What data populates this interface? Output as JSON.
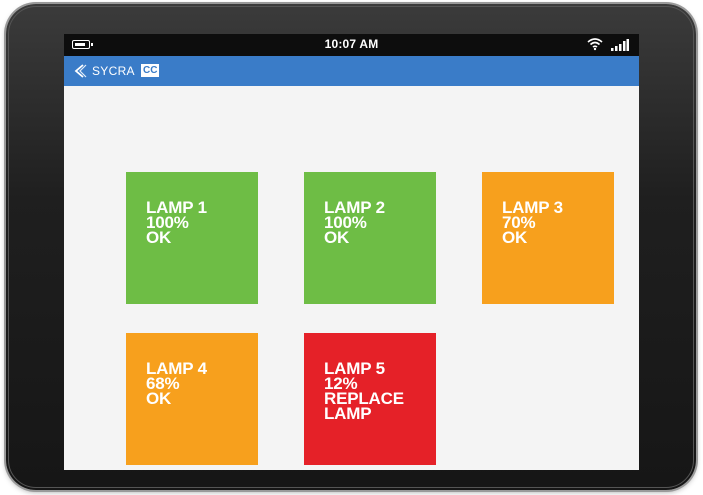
{
  "status_bar": {
    "time": "10:07 AM"
  },
  "app_bar": {
    "brand": "SYCRA",
    "badge": "CC"
  },
  "lamps": [
    {
      "name": "LAMP 1",
      "level": "100%",
      "status": "OK",
      "status_line2": "",
      "color": "#6ebd45"
    },
    {
      "name": "LAMP 2",
      "level": "100%",
      "status": "OK",
      "status_line2": "",
      "color": "#6ebd45"
    },
    {
      "name": "LAMP 3",
      "level": "70%",
      "status": "OK",
      "status_line2": "",
      "color": "#f7a01d"
    },
    {
      "name": "LAMP 4",
      "level": "68%",
      "status": "OK",
      "status_line2": "",
      "color": "#f7a01d"
    },
    {
      "name": "LAMP 5",
      "level": "12%",
      "status": "REPLACE",
      "status_line2": "LAMP",
      "color": "#e52128"
    }
  ],
  "colors": {
    "appbar": "#3a7cc8",
    "ok": "#6ebd45",
    "warning": "#f7a01d",
    "critical": "#e52128"
  },
  "icons": [
    "battery-icon",
    "wifi-icon",
    "signal-icon",
    "back-icon"
  ]
}
